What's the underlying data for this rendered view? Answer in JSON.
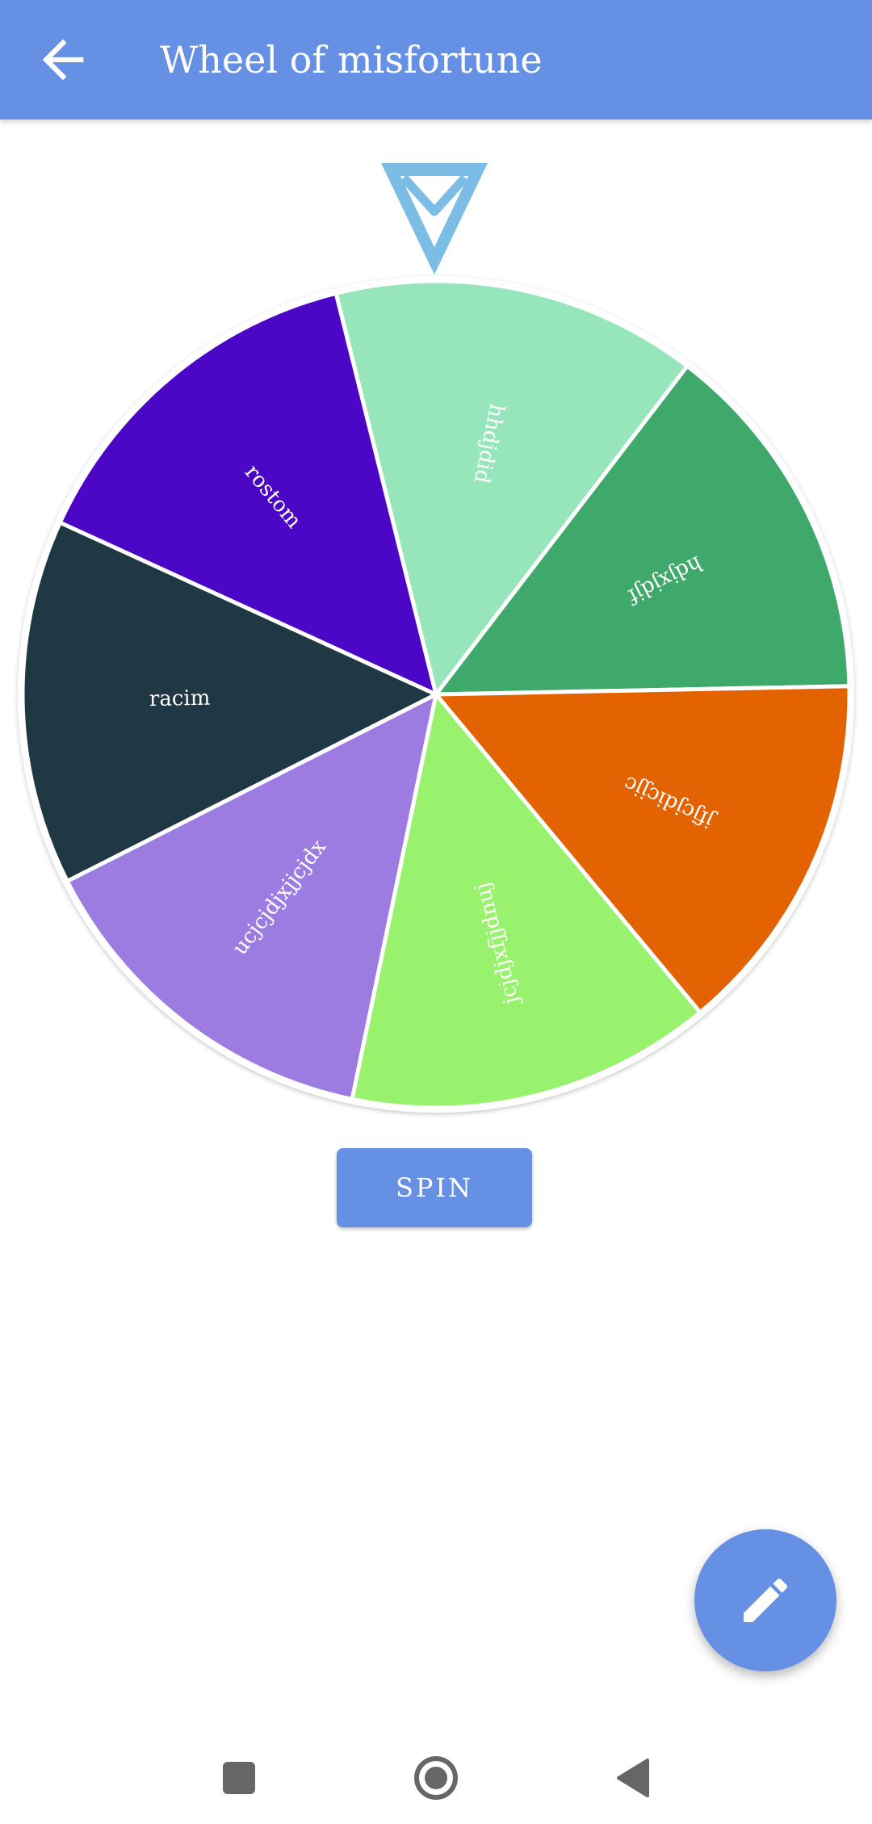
{
  "app_bar": {
    "title": "Wheel of misfortune",
    "background": "#6690e4",
    "back_icon": "arrow-left-icon"
  },
  "wheel": {
    "pointer_color": "#7bbde5",
    "segments": [
      {
        "label": "hhdjdid",
        "color": "#97e6bb"
      },
      {
        "label": "hdjxjdjf",
        "color": "#3ea96a"
      },
      {
        "label": "jfjcjdicjjc",
        "color": "#e36202"
      },
      {
        "label": "jcjdjxfjjdnuj",
        "color": "#99f26e"
      },
      {
        "label": "ucjcjdjxjjcjdx",
        "color": "#9c7ce0"
      },
      {
        "label": "racim",
        "color": "#1f3844"
      },
      {
        "label": "rostom",
        "color": "#4b06c6"
      }
    ]
  },
  "actions": {
    "spin_label": "SPIN",
    "edit_icon": "pencil-icon"
  },
  "system_nav": {
    "recents_icon": "square-icon",
    "home_icon": "circle-home-icon",
    "back_icon": "triangle-back-icon"
  }
}
